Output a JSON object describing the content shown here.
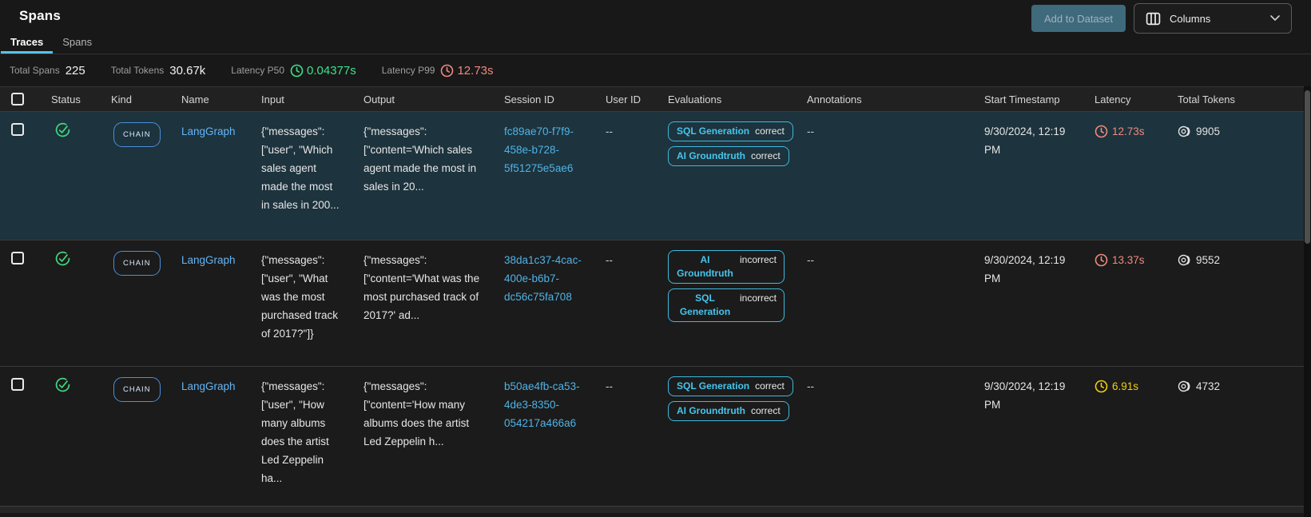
{
  "header": {
    "title": "Spans",
    "add_to_dataset_label": "Add to Dataset",
    "columns_label": "Columns"
  },
  "tabs": {
    "traces": "Traces",
    "spans": "Spans"
  },
  "stats": {
    "total_spans_label": "Total Spans",
    "total_spans_value": "225",
    "total_tokens_label": "Total Tokens",
    "total_tokens_value": "30.67k",
    "latency_p50_label": "Latency P50",
    "latency_p50_value": "0.04377s",
    "latency_p50_color": "#3ee08d",
    "latency_p99_label": "Latency P99",
    "latency_p99_value": "12.73s",
    "latency_p99_color": "#f08a7e"
  },
  "table": {
    "columns": {
      "status": "Status",
      "kind": "Kind",
      "name": "Name",
      "input": "Input",
      "output": "Output",
      "session_id": "Session ID",
      "user_id": "User ID",
      "evaluations": "Evaluations",
      "annotations": "Annotations",
      "start_timestamp": "Start Timestamp",
      "latency": "Latency",
      "total_tokens": "Total Tokens"
    },
    "rows": [
      {
        "status": "ok",
        "kind": "CHAIN",
        "name": "LangGraph",
        "input": "{\"messages\": [\"user\", \"Which sales agent made the most in sales in 200...",
        "output": "{\"messages\": [\"content='Which sales agent made the most in sales in 20...",
        "session_id": "fc89ae70-f7f9-458e-b728-5f51275e5ae6",
        "user_id": "--",
        "evaluations": [
          {
            "label": "SQL Generation",
            "value": "correct"
          },
          {
            "label": "AI Groundtruth",
            "value": "correct"
          }
        ],
        "annotations": "--",
        "start_timestamp": "9/30/2024, 12:19 PM",
        "latency": "12.73s",
        "latency_color": "#f08a7e",
        "total_tokens": "9905",
        "row_bg": "#1d333d"
      },
      {
        "status": "ok",
        "kind": "CHAIN",
        "name": "LangGraph",
        "input": "{\"messages\": [\"user\", \"What was the most purchased track of 2017?\"]}",
        "output": "{\"messages\": [\"content='What was the most purchased track of 2017?' ad...",
        "session_id": "38da1c37-4cac-400e-b6b7-dc56c75fa708",
        "user_id": "--",
        "evaluations": [
          {
            "label": "AI Groundtruth",
            "value": "incorrect"
          },
          {
            "label": "SQL Generation",
            "value": "incorrect"
          }
        ],
        "annotations": "--",
        "start_timestamp": "9/30/2024, 12:19 PM",
        "latency": "13.37s",
        "latency_color": "#f08a7e",
        "total_tokens": "9552",
        "row_bg": "#1b1b1b"
      },
      {
        "status": "ok",
        "kind": "CHAIN",
        "name": "LangGraph",
        "input": "{\"messages\": [\"user\", \"How many albums does the artist Led Zeppelin ha...",
        "output": "{\"messages\": [\"content='How many albums does the artist Led Zeppelin h...",
        "session_id": "b50ae4fb-ca53-4de3-8350-054217a466a6",
        "user_id": "--",
        "evaluations": [
          {
            "label": "SQL Generation",
            "value": "correct"
          },
          {
            "label": "AI Groundtruth",
            "value": "correct"
          }
        ],
        "annotations": "--",
        "start_timestamp": "9/30/2024, 12:19 PM",
        "latency": "6.91s",
        "latency_color": "#f2cf0e",
        "total_tokens": "4732",
        "row_bg": "#1b1b1b"
      }
    ]
  },
  "colors": {
    "tab_accent": "#56c3e8",
    "name_link": "#64b5f6",
    "session_link": "#4fb3e6",
    "eval_pill_border": "#3fb9de",
    "eval_pill_label": "#45c6ee",
    "status_green": "#42d77d",
    "selected_row_bg": "#1d333d",
    "latency_red": "#f08a7e",
    "latency_yellow": "#f2cf0e",
    "latency_green": "#3ee08d",
    "add_button_bg": "#3e6a7c"
  }
}
